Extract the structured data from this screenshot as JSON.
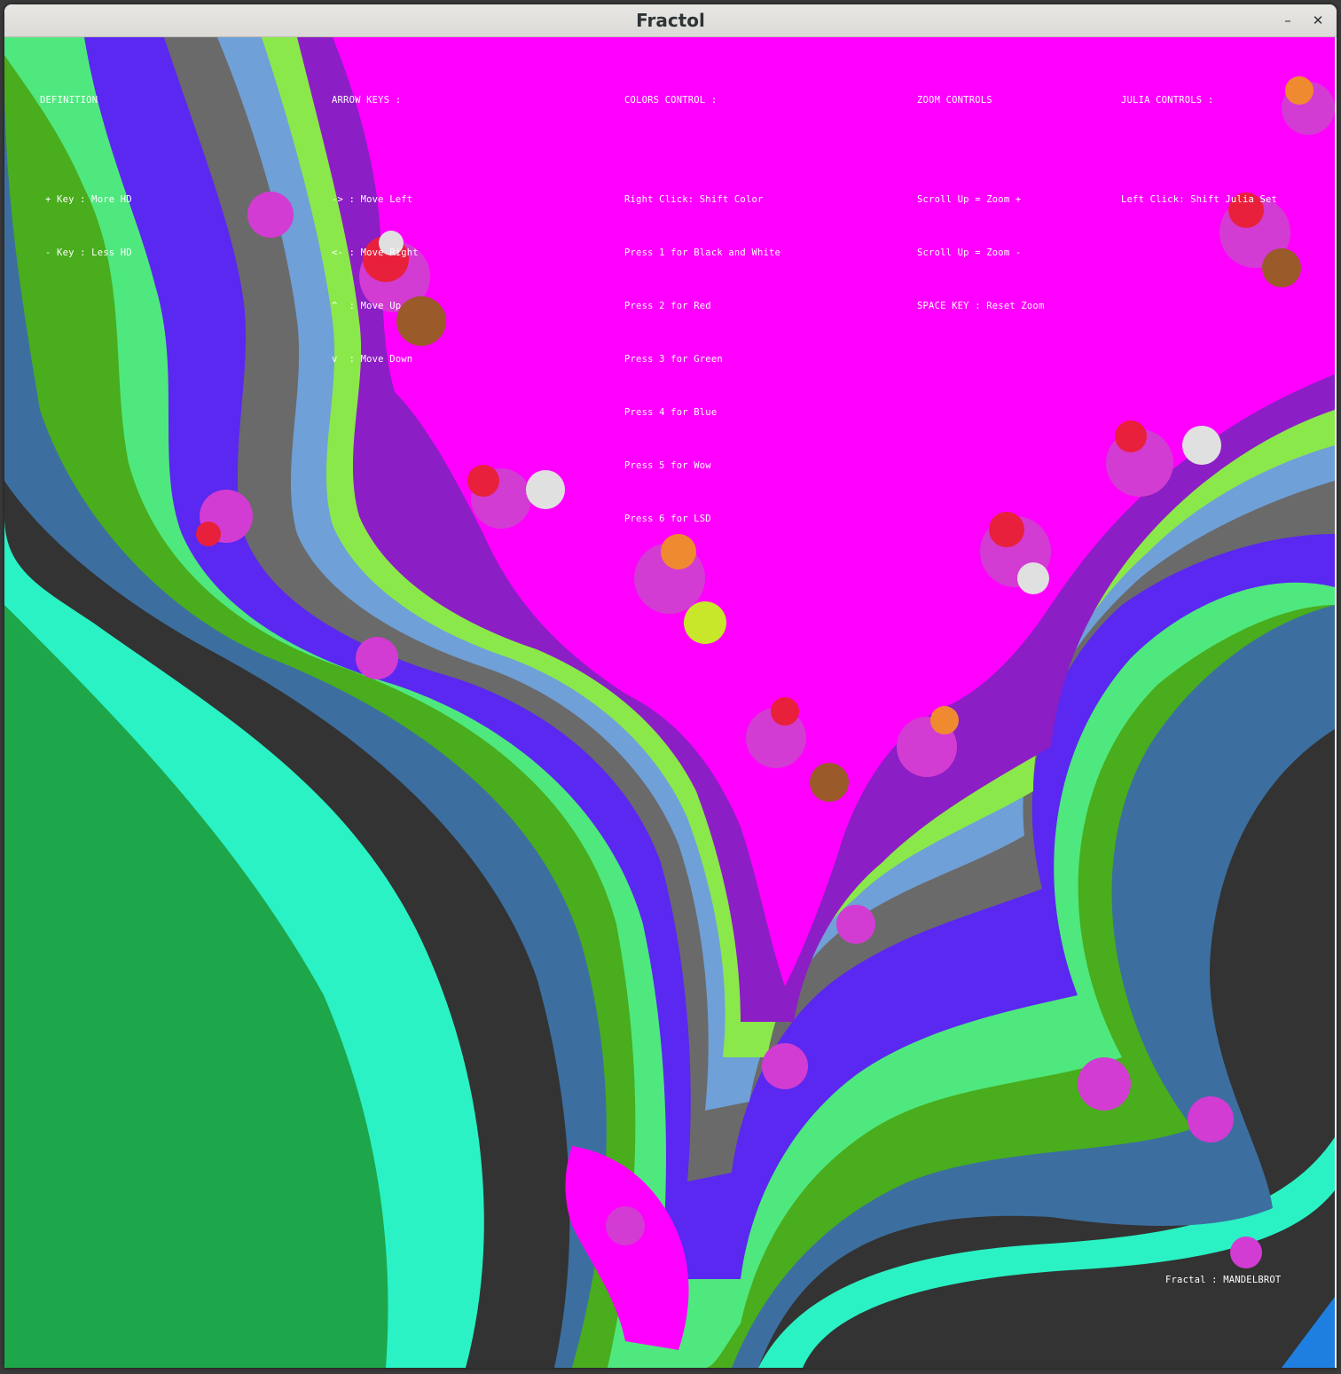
{
  "window": {
    "title": "Fractol",
    "minimize_glyph": "–",
    "close_glyph": "✕"
  },
  "panels": {
    "definition": {
      "heading": "DEFINITION",
      "items": [
        "+ Key : More HD",
        "- Key : Less HD"
      ]
    },
    "arrows": {
      "heading": "ARROW KEYS :",
      "items": [
        "-> : Move Left",
        "<- : Move Right",
        "^  : Move Up",
        "v  : Move Down"
      ]
    },
    "colors": {
      "heading": "COLORS CONTROL :",
      "items": [
        "Right Click: Shift Color",
        "Press 1 for Black and White",
        "Press 2 for Red",
        "Press 3 for Green",
        "Press 4 for Blue",
        "Press 5 for Wow",
        "Press 6 for LSD"
      ]
    },
    "zoom": {
      "heading": "ZOOM CONTROLS",
      "items": [
        "Scroll Up = Zoom +",
        "Scroll Up = Zoom -",
        "SPACE KEY : Reset Zoom"
      ]
    },
    "julia": {
      "heading": "JULIA CONTROLS :",
      "items": [
        "Left Click: Shift Julia Set"
      ]
    }
  },
  "status": {
    "fractal_label": "Fractal : MANDELBROT"
  },
  "palette": {
    "interior": "#ff00ff",
    "bands": [
      "#1da64a",
      "#2af2c4",
      "#333333",
      "#3c6fa0",
      "#49ad1d",
      "#4fe87e",
      "#5a28f0",
      "#6a6a6a",
      "#6fa0d8",
      "#8be84a",
      "#8b1ec4",
      "#9a5a2a",
      "#c8e62a",
      "#d23cd2",
      "#e0e0e0",
      "#e8203c",
      "#f08a30"
    ]
  }
}
